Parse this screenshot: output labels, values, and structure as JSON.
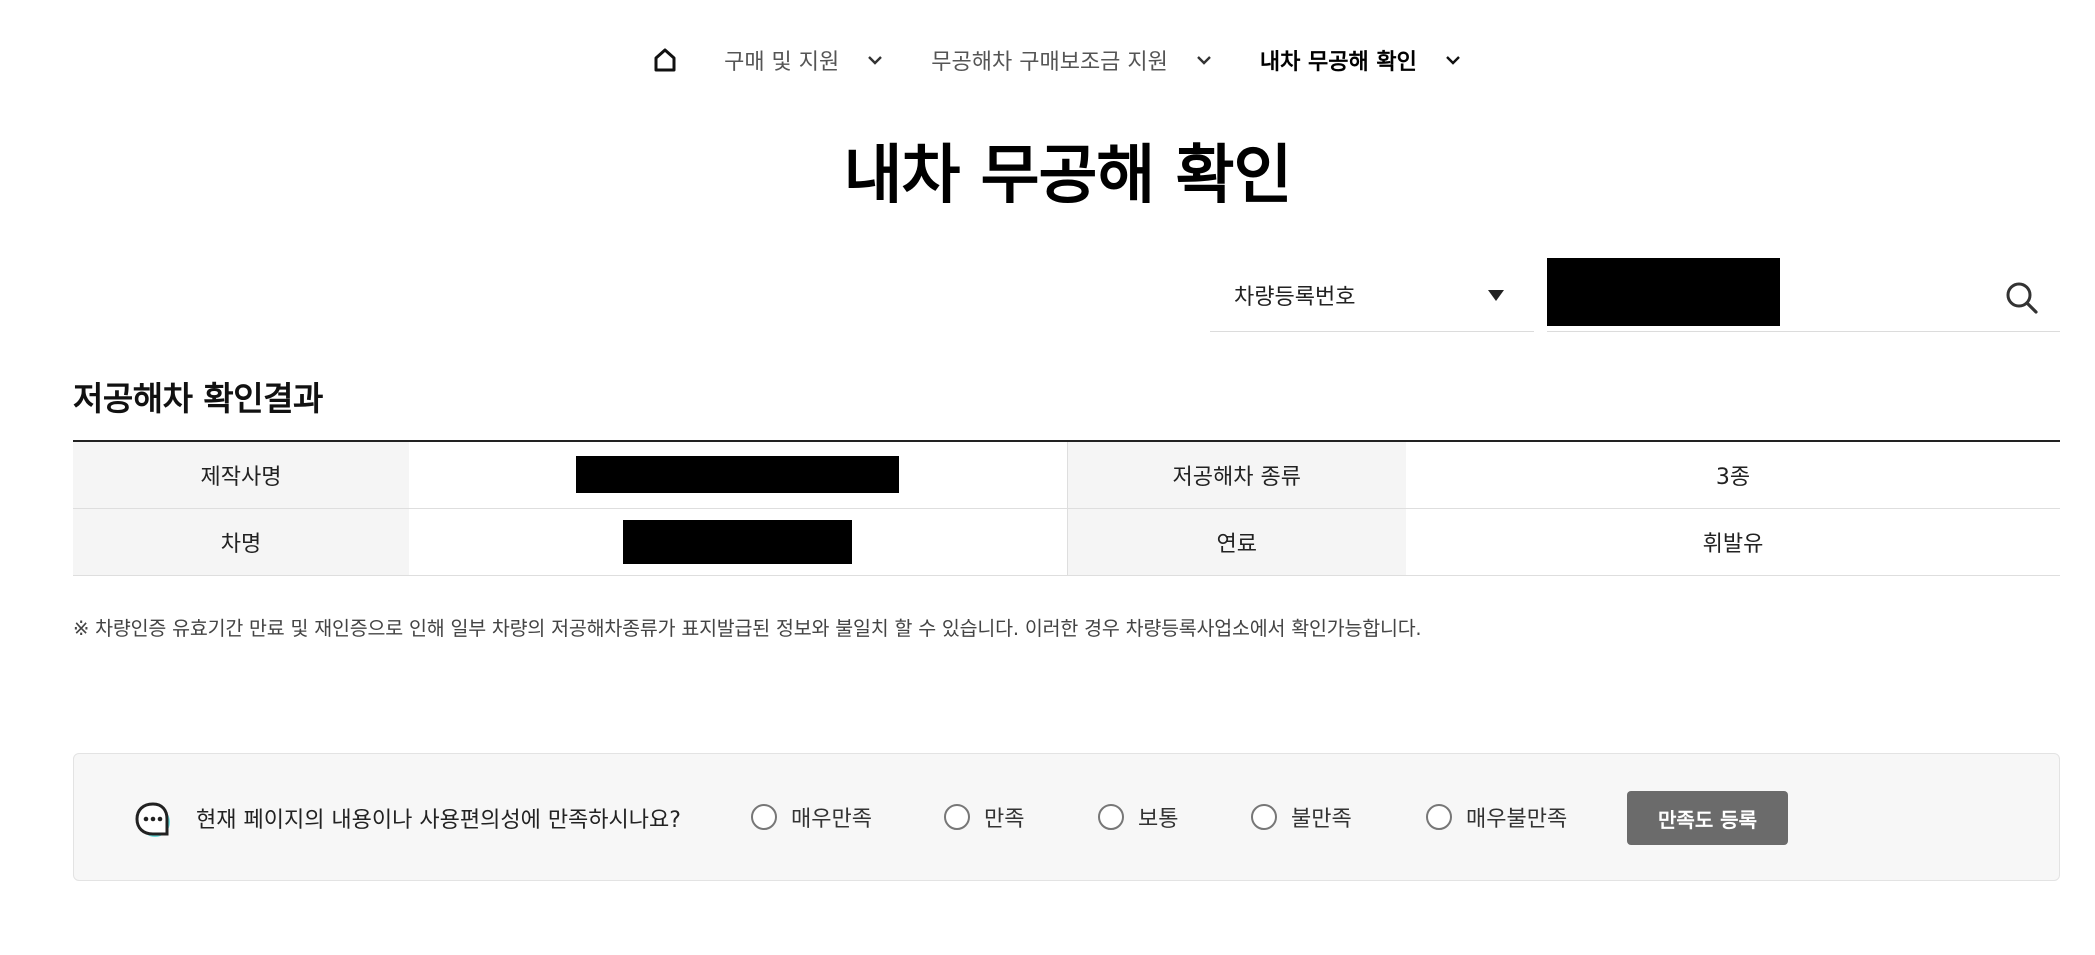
{
  "breadcrumb": {
    "home_icon": "home-icon",
    "items": [
      {
        "label": "구매 및 지원"
      },
      {
        "label": "무공해차 구매보조금 지원"
      },
      {
        "label": "내차 무공해 확인"
      }
    ]
  },
  "page_title": "내차 무공해 확인",
  "search": {
    "select_value": "차량등록번호",
    "input_value": "",
    "icon": "search-icon"
  },
  "result": {
    "title": "저공해차 확인결과",
    "rows": [
      {
        "label1": "제작사명",
        "value1": "",
        "label2": "저공해차 종류",
        "value2": "3종"
      },
      {
        "label1": "차명",
        "value1": "",
        "label2": "연료",
        "value2": "휘발유"
      }
    ]
  },
  "notice": "※ 차량인증 유효기간 만료 및 재인증으로 인해 일부 차량의 저공해차종류가 표지발급된 정보와 불일치 할 수 있습니다. 이러한 경우 차량등록사업소에서 확인가능합니다.",
  "survey": {
    "icon": "chat-bubble-icon",
    "question": "현재 페이지의 내용이나 사용편의성에 만족하시나요?",
    "options": [
      "매우만족",
      "만족",
      "보통",
      "불만족",
      "매우불만족"
    ],
    "submit_label": "만족도 등록"
  }
}
